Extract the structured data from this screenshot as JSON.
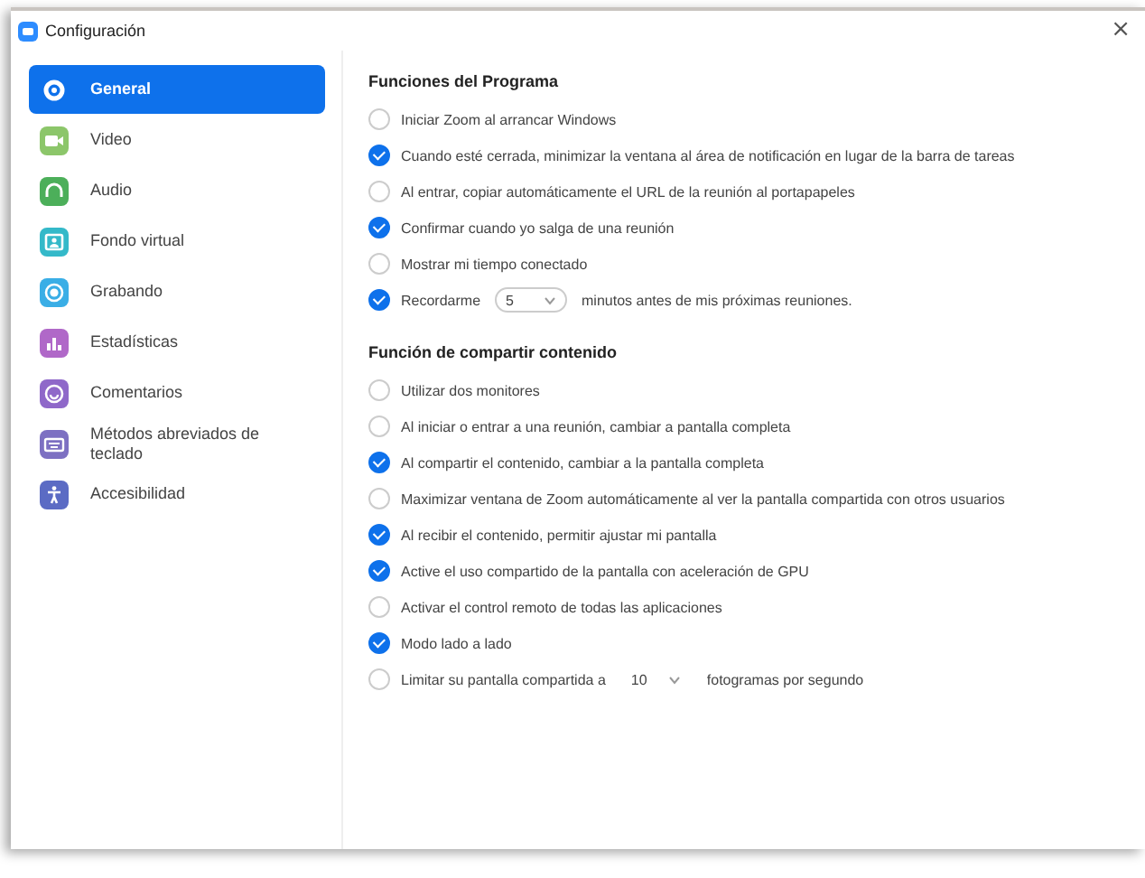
{
  "window": {
    "title": "Configuración",
    "close": "×"
  },
  "sidebar": {
    "items": [
      {
        "label": "General",
        "selected": true,
        "color": "#ffffff"
      },
      {
        "label": "Video",
        "selected": false,
        "color": "#8cc66a"
      },
      {
        "label": "Audio",
        "selected": false,
        "color": "#4caf5a"
      },
      {
        "label": "Fondo virtual",
        "selected": false,
        "color": "#34b9c9"
      },
      {
        "label": "Grabando",
        "selected": false,
        "color": "#3aaee6"
      },
      {
        "label": "Estadísticas",
        "selected": false,
        "color": "#b068c8"
      },
      {
        "label": "Comentarios",
        "selected": false,
        "color": "#8f68c9"
      },
      {
        "label": "Métodos abreviados de teclado",
        "selected": false,
        "color": "#7d70c2"
      },
      {
        "label": "Accesibilidad",
        "selected": false,
        "color": "#5b6bc4"
      }
    ]
  },
  "sections": [
    {
      "title": "Funciones del Programa",
      "options": [
        {
          "kind": "checkbox",
          "label": "Iniciar Zoom al arrancar Windows",
          "checked": false
        },
        {
          "kind": "checkbox",
          "label": "Cuando esté cerrada, minimizar la ventana al área de notificación en lugar de la barra de tareas",
          "checked": true
        },
        {
          "kind": "checkbox",
          "label": "Al entrar, copiar automáticamente el URL de la reunión al portapapeles",
          "checked": false
        },
        {
          "kind": "checkbox",
          "label": "Confirmar cuando yo salga de una reunión",
          "checked": true
        },
        {
          "kind": "checkbox",
          "label": "Mostrar mi tiempo conectado",
          "checked": false
        },
        {
          "kind": "select",
          "label": "Recordarme",
          "value": "5",
          "after": "minutos antes de mis próximas reuniones.",
          "checked": true,
          "bordered": true
        }
      ]
    },
    {
      "title": "Función de compartir contenido",
      "options": [
        {
          "kind": "checkbox",
          "label": "Utilizar dos monitores",
          "checked": false
        },
        {
          "kind": "checkbox",
          "label": "Al iniciar o entrar a una reunión, cambiar a pantalla completa",
          "checked": false
        },
        {
          "kind": "checkbox",
          "label": "Al compartir el contenido, cambiar a la pantalla completa",
          "checked": true
        },
        {
          "kind": "checkbox",
          "label": "Maximizar ventana de Zoom automáticamente al ver la pantalla compartida con otros usuarios",
          "checked": false
        },
        {
          "kind": "checkbox",
          "label": "Al recibir el contenido, permitir ajustar mi pantalla",
          "checked": true
        },
        {
          "kind": "checkbox",
          "label": "Active el uso compartido de la pantalla con aceleración de GPU",
          "checked": true
        },
        {
          "kind": "checkbox",
          "label": "Activar el control remoto de todas las aplicaciones",
          "checked": false
        },
        {
          "kind": "checkbox",
          "label": "Modo lado a lado",
          "checked": true
        },
        {
          "kind": "select",
          "label": "Limitar su pantalla compartida a",
          "value": "10",
          "after": "fotogramas por segundo",
          "checked": false,
          "bordered": false
        }
      ]
    }
  ]
}
